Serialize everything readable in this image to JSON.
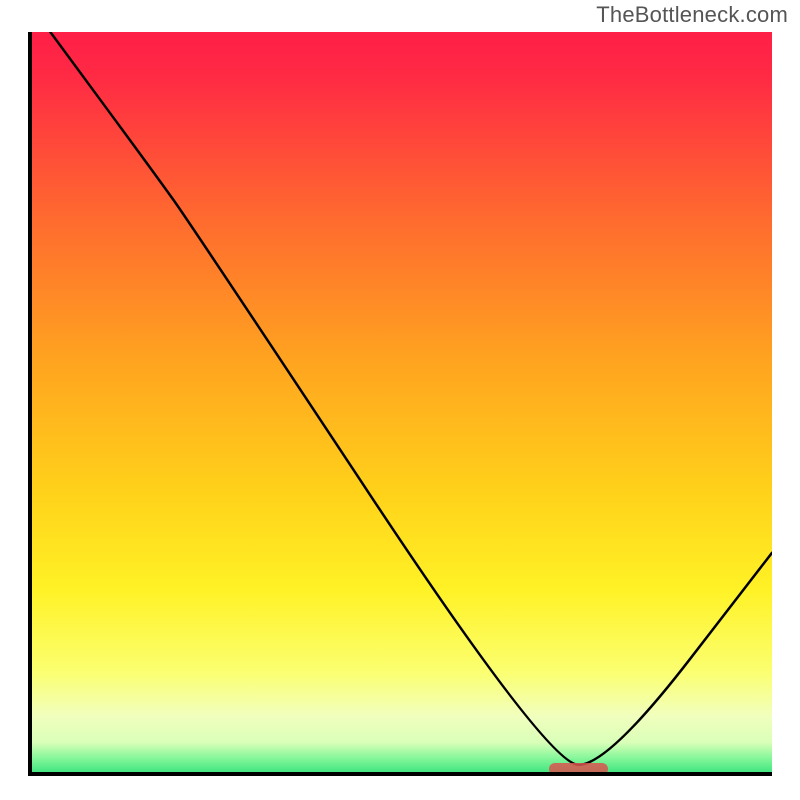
{
  "watermark": "TheBottleneck.com",
  "chart_data": {
    "type": "line",
    "title": "",
    "xlabel": "",
    "ylabel": "",
    "xlim": [
      0,
      100
    ],
    "ylim": [
      0,
      100
    ],
    "grid": false,
    "legend": false,
    "marker": {
      "x_start": 70,
      "x_end": 78,
      "y": 1.0
    },
    "curve_points": [
      {
        "x": 3,
        "y": 100
      },
      {
        "x": 17,
        "y": 81
      },
      {
        "x": 22,
        "y": 74
      },
      {
        "x": 70,
        "y": 1.5
      },
      {
        "x": 78,
        "y": 1.5
      },
      {
        "x": 100,
        "y": 30
      }
    ],
    "gradient_stops": [
      {
        "offset": 0.0,
        "color": "#ff1f47"
      },
      {
        "offset": 0.06,
        "color": "#ff2a44"
      },
      {
        "offset": 0.25,
        "color": "#ff6a2f"
      },
      {
        "offset": 0.45,
        "color": "#ffa61f"
      },
      {
        "offset": 0.62,
        "color": "#ffd21a"
      },
      {
        "offset": 0.75,
        "color": "#fff226"
      },
      {
        "offset": 0.86,
        "color": "#fbff70"
      },
      {
        "offset": 0.92,
        "color": "#f1ffbe"
      },
      {
        "offset": 0.955,
        "color": "#d9ffb8"
      },
      {
        "offset": 0.975,
        "color": "#89f79b"
      },
      {
        "offset": 1.0,
        "color": "#2fe27a"
      }
    ]
  }
}
